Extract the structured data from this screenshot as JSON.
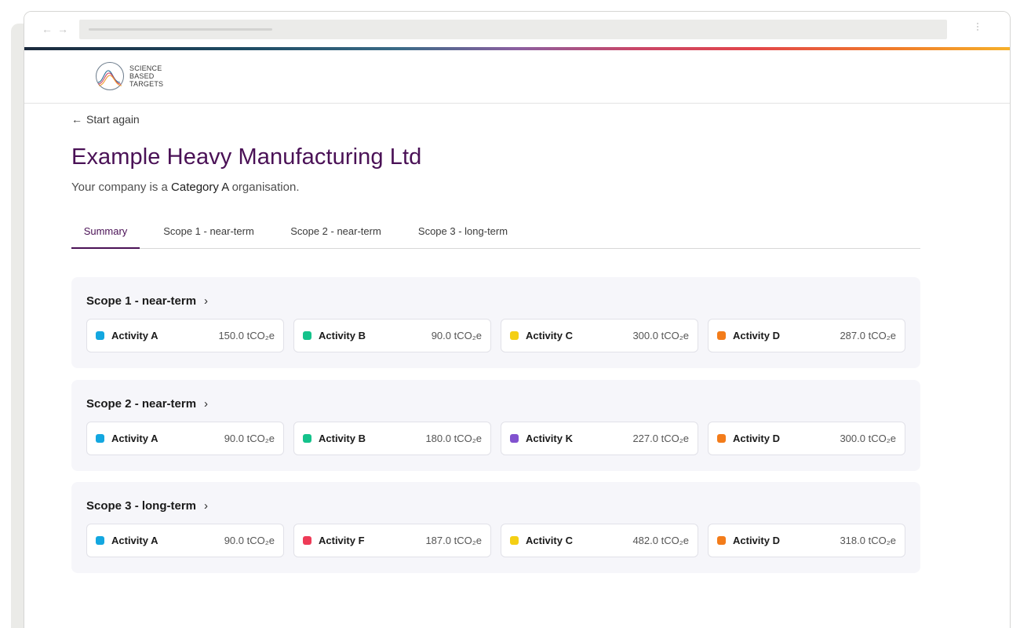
{
  "colors": {
    "primary": "#4a1156",
    "activity_a": "#13a7e0",
    "activity_b": "#14c28b",
    "activity_c": "#f4cf14",
    "activity_d": "#f37c1a",
    "activity_k": "#8152cf",
    "activity_f": "#ee3b57"
  },
  "browser": {
    "back_icon": "arrow-left-icon",
    "forward_icon": "arrow-right-icon",
    "menu_icon": "kebab-menu-icon"
  },
  "header": {
    "logo_icon": "sbti-logo-icon",
    "logo_lines": [
      "SCIENCE",
      "BASED",
      "TARGETS"
    ]
  },
  "back_link": {
    "arrow": "←",
    "label": "Start again"
  },
  "page": {
    "title": "Example Heavy Manufacturing Ltd",
    "subtitle_prefix": "Your company is a ",
    "subtitle_category": "Category A",
    "subtitle_suffix": " organisation."
  },
  "tabs": [
    {
      "label": "Summary",
      "active": true
    },
    {
      "label": "Scope 1 - near-term",
      "active": false
    },
    {
      "label": "Scope 2 - near-term",
      "active": false
    },
    {
      "label": "Scope 3 - long-term",
      "active": false
    }
  ],
  "scopes": [
    {
      "title": "Scope 1 - near-term",
      "chevron": "›",
      "activities": [
        {
          "name": "Activity A",
          "value": "150.0 tCO₂e",
          "color": "#13a7e0"
        },
        {
          "name": "Activity B",
          "value": "90.0 tCO₂e",
          "color": "#14c28b"
        },
        {
          "name": "Activity C",
          "value": "300.0 tCO₂e",
          "color": "#f4cf14"
        },
        {
          "name": "Activity D",
          "value": "287.0 tCO₂e",
          "color": "#f37c1a"
        }
      ]
    },
    {
      "title": "Scope 2 - near-term",
      "chevron": "›",
      "activities": [
        {
          "name": "Activity A",
          "value": "90.0 tCO₂e",
          "color": "#13a7e0"
        },
        {
          "name": "Activity B",
          "value": "180.0 tCO₂e",
          "color": "#14c28b"
        },
        {
          "name": "Activity K",
          "value": "227.0 tCO₂e",
          "color": "#8152cf"
        },
        {
          "name": "Activity D",
          "value": "300.0 tCO₂e",
          "color": "#f37c1a"
        }
      ]
    },
    {
      "title": "Scope 3 - long-term",
      "chevron": "›",
      "activities": [
        {
          "name": "Activity A",
          "value": "90.0 tCO₂e",
          "color": "#13a7e0"
        },
        {
          "name": "Activity F",
          "value": "187.0 tCO₂e",
          "color": "#ee3b57"
        },
        {
          "name": "Activity C",
          "value": "482.0 tCO₂e",
          "color": "#f4cf14"
        },
        {
          "name": "Activity D",
          "value": "318.0 tCO₂e",
          "color": "#f37c1a"
        }
      ]
    }
  ]
}
